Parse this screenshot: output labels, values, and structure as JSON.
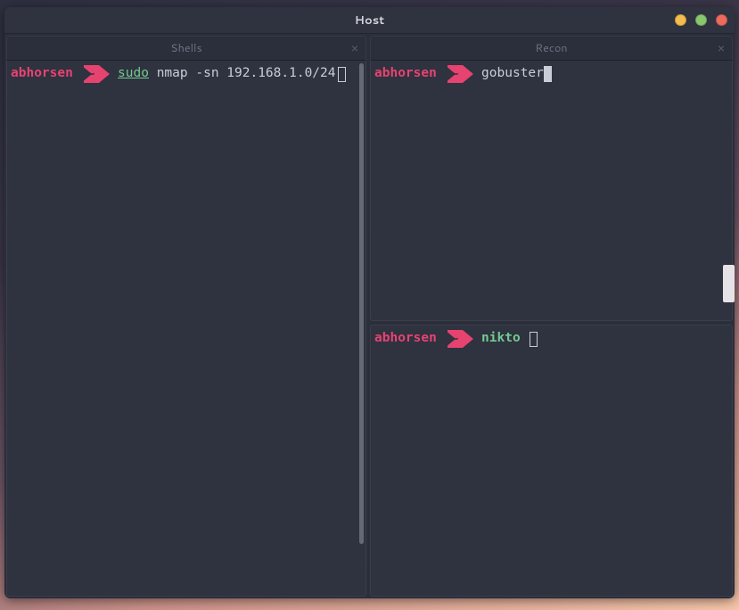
{
  "window": {
    "title": "Host"
  },
  "tabs": {
    "left": {
      "title": "Shells",
      "close": "×"
    },
    "right": {
      "title": "Recon",
      "close": "×"
    }
  },
  "prompt": {
    "user": "abhorsen",
    "path": "~"
  },
  "panes": {
    "left": {
      "sudo": "sudo",
      "cmd": "nmap",
      "args": "-sn 192.168.1.0/24"
    },
    "right_top": {
      "cmd": "gobuster"
    },
    "right_bottom": {
      "cmd": "nikto"
    }
  }
}
